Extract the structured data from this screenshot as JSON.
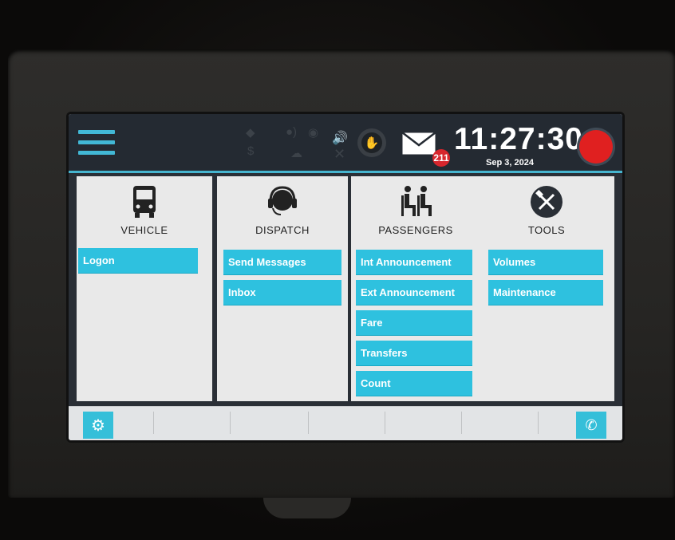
{
  "topbar": {
    "time": "11:27:30",
    "date": "Sep 3, 2024",
    "mail_badge": "211",
    "icons": [
      "menu-icon",
      "signal-icon",
      "dollar-icon",
      "person-audio-icon",
      "headset-icon",
      "cloud-icon",
      "speaker-icon",
      "x-icon",
      "hand-stop-icon",
      "mail-icon",
      "record-icon"
    ],
    "accent_color": "#42b8d6",
    "record_color": "#e02020"
  },
  "panels": [
    {
      "title": "VEHICLE",
      "icon": "bus-icon",
      "buttons": [
        "Logon"
      ]
    },
    {
      "title": "DISPATCH",
      "icon": "headset-icon",
      "buttons": [
        "Send Messages",
        "Inbox"
      ]
    },
    {
      "title": "PASSENGERS",
      "icon": "passengers-icon",
      "buttons": [
        "Int  Announcement",
        "Ext  Announcement",
        "Fare",
        "Transfers",
        "Count"
      ]
    },
    {
      "title": "TOOLS",
      "icon": "tools-icon",
      "buttons": [
        "Volumes",
        "Maintenance"
      ]
    }
  ],
  "bottombar": {
    "icons": [
      "gear-icon",
      "phone-alert-icon"
    ]
  },
  "colors": {
    "button": "#2ec1df",
    "topbar": "#242a32",
    "panel_bg": "#e9e9e9"
  }
}
